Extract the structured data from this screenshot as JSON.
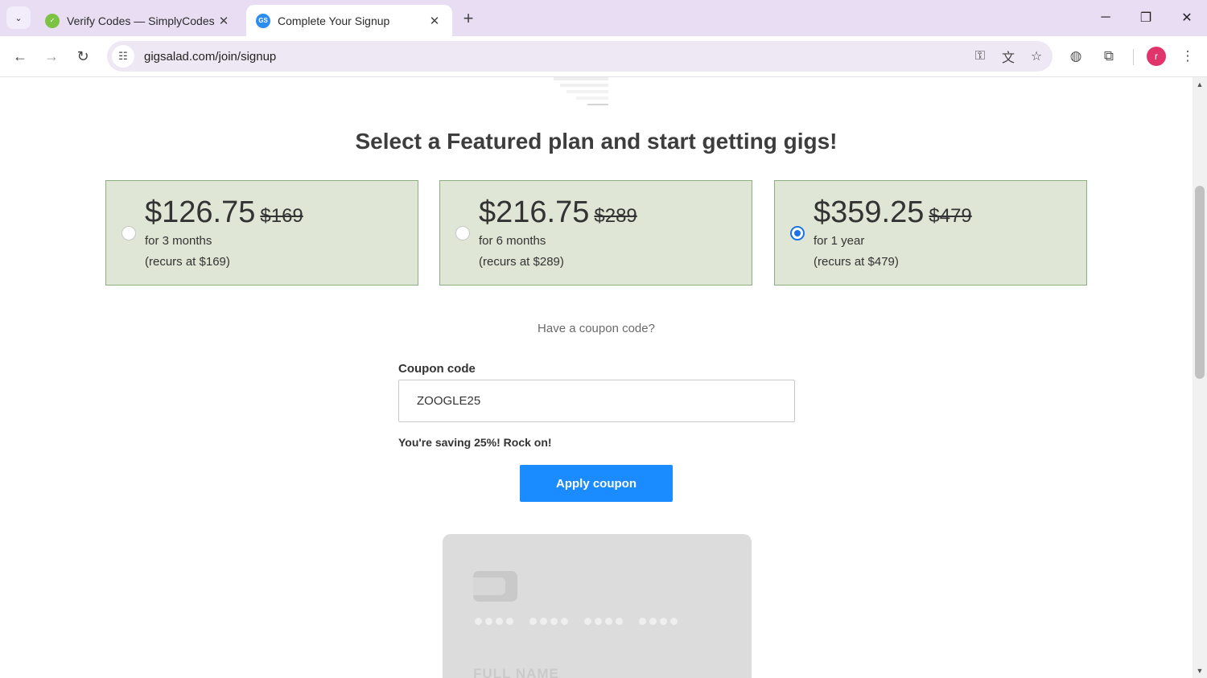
{
  "browser": {
    "tabs": [
      {
        "title": "Verify Codes — SimplyCodes",
        "favicon": "simplycodes-icon"
      },
      {
        "title": "Complete Your Signup",
        "favicon": "gs-icon",
        "favicon_text": "GS"
      }
    ],
    "url": "gigsalad.com/join/signup",
    "profile_initial": "r"
  },
  "page": {
    "headline": "Select a Featured plan and start getting gigs!",
    "plans": [
      {
        "price": "$126.75",
        "old_price": "$169",
        "term": "for 3 months",
        "recurs": "(recurs at $169)",
        "selected": false
      },
      {
        "price": "$216.75",
        "old_price": "$289",
        "term": "for 6 months",
        "recurs": "(recurs at $289)",
        "selected": false
      },
      {
        "price": "$359.25",
        "old_price": "$479",
        "term": "for 1 year",
        "recurs": "(recurs at $479)",
        "selected": true
      }
    ],
    "coupon": {
      "prompt": "Have a coupon code?",
      "label": "Coupon code",
      "value": "ZOOGLE25",
      "success": "You're saving 25%! Rock on!",
      "apply_label": "Apply coupon"
    },
    "card": {
      "name_placeholder": "FULL NAME"
    }
  },
  "colors": {
    "plan_bg": "#dfe6d5",
    "plan_border": "#8ab07f",
    "accent": "#1a8cff",
    "tabbar": "#e8ddf3"
  }
}
